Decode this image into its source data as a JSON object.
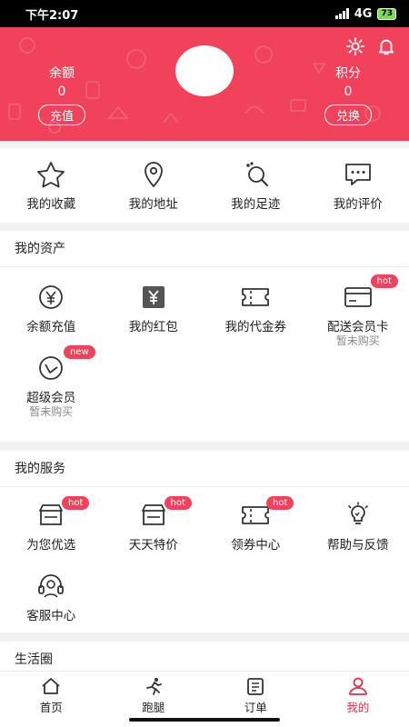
{
  "status_bar": {
    "time": "下午2:07",
    "network": "4G",
    "battery": "73"
  },
  "header": {
    "balance": {
      "label": "余额",
      "value": "0",
      "button": "充值"
    },
    "points": {
      "label": "积分",
      "value": "0",
      "button": "兑换"
    },
    "icons": [
      "gear-icon",
      "bell-icon"
    ]
  },
  "quick_actions": [
    {
      "label": "我的收藏",
      "icon": "star-icon"
    },
    {
      "label": "我的地址",
      "icon": "location-pin-icon"
    },
    {
      "label": "我的足迹",
      "icon": "footprint-icon"
    },
    {
      "label": "我的评价",
      "icon": "comment-icon"
    }
  ],
  "assets": {
    "title": "我的资产",
    "items": [
      {
        "label": "余额充值",
        "icon": "yen-circle-icon"
      },
      {
        "label": "我的红包",
        "icon": "red-packet-icon"
      },
      {
        "label": "我的代金券",
        "icon": "voucher-icon"
      },
      {
        "label": "配送会员卡",
        "icon": "card-icon",
        "badge": "hot",
        "sub": "暂未购买"
      },
      {
        "label": "超级会员",
        "icon": "super-vip-icon",
        "badge": "new",
        "sub": "暂未购买"
      }
    ]
  },
  "services": {
    "title": "我的服务",
    "items": [
      {
        "label": "为您优选",
        "icon": "store-icon",
        "badge": "hot"
      },
      {
        "label": "天天特价",
        "icon": "store-icon",
        "badge": "hot"
      },
      {
        "label": "领券中心",
        "icon": "ticket-icon",
        "badge": "hot"
      },
      {
        "label": "帮助与反馈",
        "icon": "lightbulb-icon"
      },
      {
        "label": "客服中心",
        "icon": "headset-icon"
      }
    ]
  },
  "life_circle": {
    "title": "生活圈"
  },
  "tabbar": {
    "items": [
      {
        "label": "首页",
        "icon": "home-icon"
      },
      {
        "label": "跑腿",
        "icon": "runner-icon"
      },
      {
        "label": "订单",
        "icon": "order-list-icon"
      },
      {
        "label": "我的",
        "icon": "user-icon"
      }
    ],
    "active": "我的"
  },
  "colors": {
    "brand": "#f0435b",
    "active_tab": "#e0304a"
  }
}
